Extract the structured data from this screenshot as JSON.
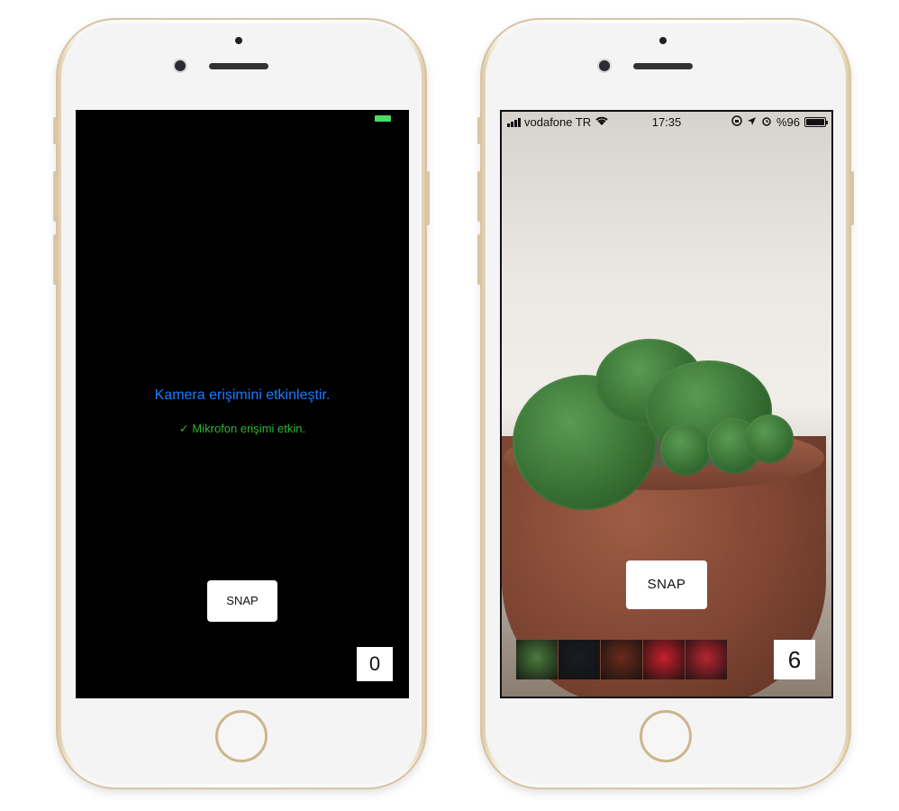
{
  "left_phone": {
    "status": {
      "battery_color": "#4cd964"
    },
    "camera_prompt": "Kamera erişimini etkinleştir.",
    "mic_status": "✓ Mikrofon erişimi etkin.",
    "snap_label": "SNAP",
    "photo_count": "0"
  },
  "right_phone": {
    "status": {
      "carrier": "vodafone TR",
      "time": "17:35",
      "battery": "%96"
    },
    "snap_label": "SNAP",
    "photo_count": "6",
    "thumbnails": [
      {
        "name": "cactus",
        "color": "#4a7a3a"
      },
      {
        "name": "night-light",
        "color": "#1a1c24"
      },
      {
        "name": "tea-glass",
        "color": "#6b2a1c"
      },
      {
        "name": "turkish-flag",
        "color": "#c81f2a"
      },
      {
        "name": "turkish-flag-2",
        "color": "#b82530"
      }
    ]
  }
}
